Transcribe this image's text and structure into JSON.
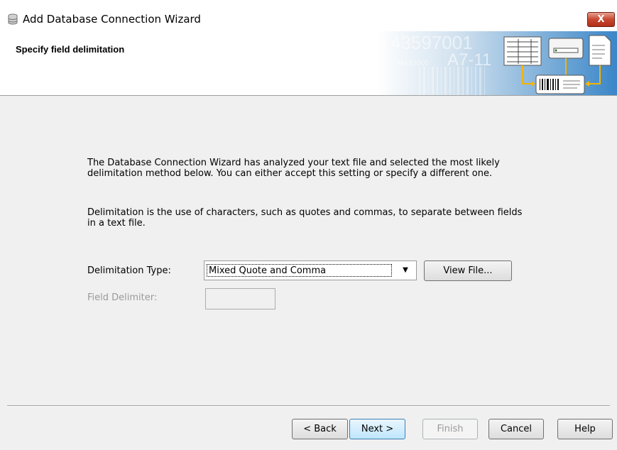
{
  "window": {
    "title": "Add Database Connection Wizard",
    "close_label": "X"
  },
  "header": {
    "title": "Specify field delimitation",
    "banner_text_1": "43597001",
    "banner_text_2": "A7-11",
    "banner_text_3": "MAX2000"
  },
  "content": {
    "paragraph1": "The Database Connection Wizard has analyzed your text file and selected the most likely delimitation method below.  You can either accept this setting or specify a different one.",
    "paragraph2": "Delimitation is the use of characters, such as quotes and commas, to separate between fields in a text file."
  },
  "form": {
    "delimitation_type_label": "Delimitation Type:",
    "delimitation_type_value": "Mixed Quote and Comma",
    "view_file_label": "View File...",
    "field_delimiter_label": "Field Delimiter:",
    "field_delimiter_value": ""
  },
  "footer": {
    "back_label": "< Back",
    "next_label": "Next >",
    "finish_label": "Finish",
    "cancel_label": "Cancel",
    "help_label": "Help"
  },
  "colors": {
    "dialog_bg": "#f0f0f0",
    "header_bg": "#ffffff",
    "banner_blue": "#3a86c8",
    "close_red": "#c7472f",
    "default_button_border": "#3c7fb1"
  }
}
